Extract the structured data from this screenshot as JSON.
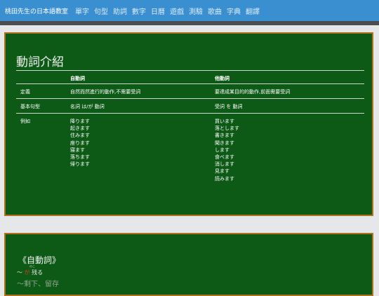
{
  "header": {
    "brand": "桃田先生の日本語教室",
    "nav": [
      "單字",
      "句型",
      "助詞",
      "數字",
      "日曆",
      "遊戲",
      "測驗",
      "歌曲",
      "字典",
      "翻譯"
    ]
  },
  "board1": {
    "title": "動詞介紹",
    "columns": [
      "",
      "自動詞",
      "他動詞"
    ],
    "rows": {
      "definition": {
        "label": "定義",
        "intransitive": "自然而然進行的動作,不需要受詞",
        "transitive": "要達成某目的的動作,前面需要受詞"
      },
      "pattern": {
        "label": "基本句型",
        "intransitive": "名詞 は/が 動詞",
        "transitive": "受詞 を 動詞"
      },
      "examples": {
        "label": "例如",
        "intransitive": [
          "降ります",
          "起きます",
          "住みます",
          "座ります",
          "寝ます",
          "落ちます",
          "帰ります"
        ],
        "transitive": [
          "買います",
          "落とします",
          "書きます",
          "聞きます",
          "します",
          "食べます",
          "消します",
          "見ます",
          "読みます"
        ]
      }
    }
  },
  "board2": {
    "title": "《自動詞》",
    "line1_prefix": "～",
    "line1_particle": "が",
    "line1_ruby": "のこ",
    "line1_word": "残る",
    "line2": "～剩下、留存"
  },
  "colors": {
    "navbar": "#3a8fd0",
    "board": "#0d5a17",
    "board_border": "#b0711f",
    "page_bg": "#e6e7e8"
  }
}
